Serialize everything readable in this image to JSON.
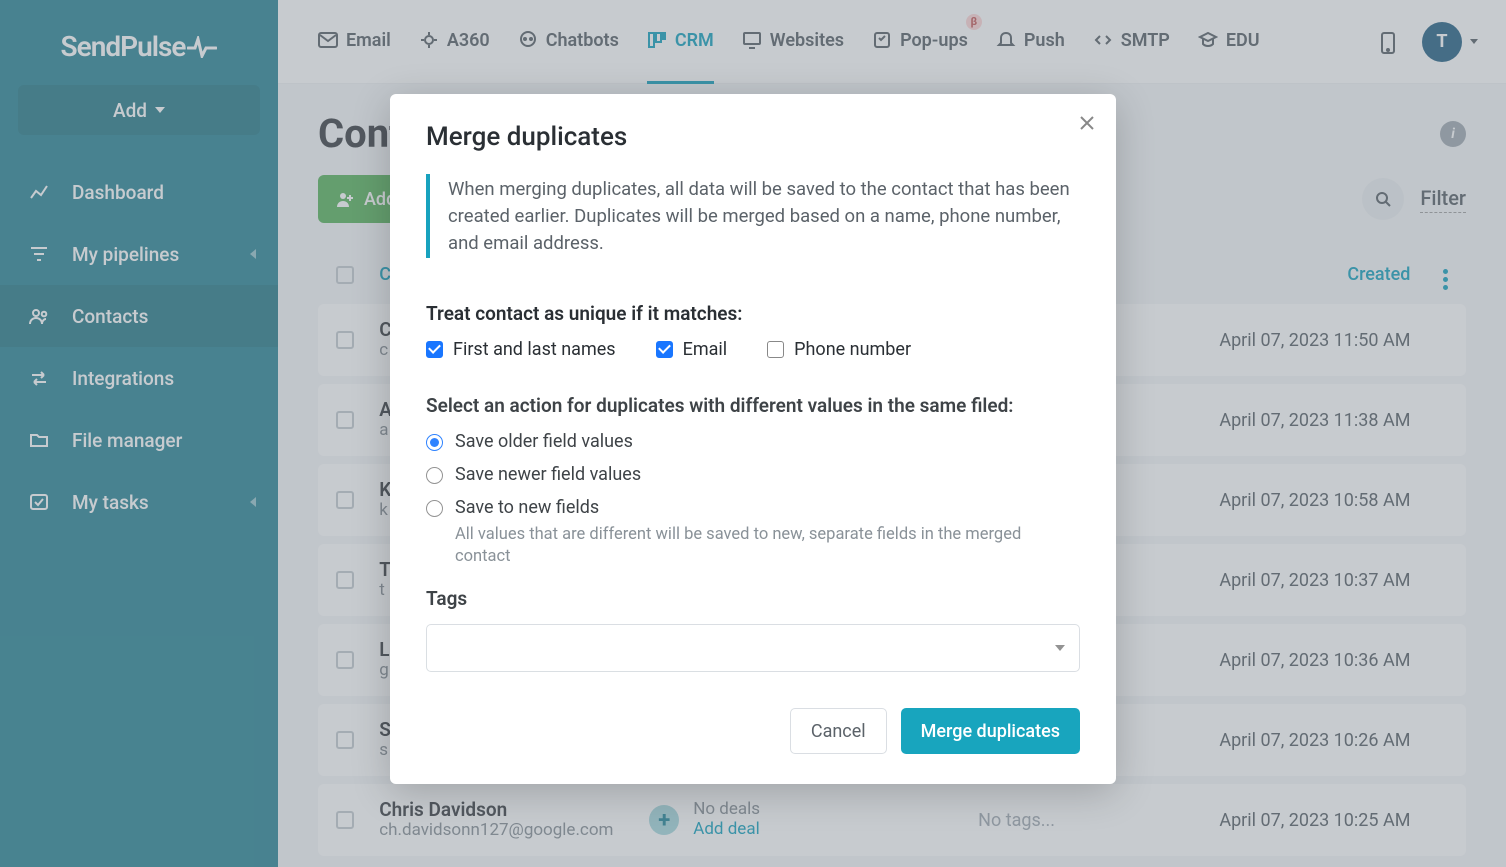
{
  "brand": "SendPulse",
  "sidebar": {
    "add_label": "Add",
    "items": [
      {
        "label": "Dashboard"
      },
      {
        "label": "My pipelines",
        "chevron": true
      },
      {
        "label": "Contacts",
        "active": true
      },
      {
        "label": "Integrations"
      },
      {
        "label": "File manager"
      },
      {
        "label": "My tasks",
        "chevron": true
      }
    ]
  },
  "topnav": [
    {
      "label": "Email"
    },
    {
      "label": "A360"
    },
    {
      "label": "Chatbots"
    },
    {
      "label": "CRM",
      "active": true
    },
    {
      "label": "Websites"
    },
    {
      "label": "Pop-ups",
      "badge": "β"
    },
    {
      "label": "Push"
    },
    {
      "label": "SMTP"
    },
    {
      "label": "EDU"
    }
  ],
  "avatar_initial": "T",
  "page": {
    "title": "Contacts",
    "add_contact": "Add contact",
    "merge_dup_btn": "Merge duplicates",
    "filter": "Filter",
    "columns": {
      "contact": "Contact",
      "created": "Created"
    }
  },
  "contacts": [
    {
      "name": "C",
      "email": "c",
      "created": "April 07, 2023 11:50 AM"
    },
    {
      "name": "A",
      "email": "a",
      "created": "April 07, 2023 11:38 AM"
    },
    {
      "name": "K",
      "email": "k",
      "created": "April 07, 2023 10:58 AM"
    },
    {
      "name": "T",
      "email": "t",
      "created": "April 07, 2023 10:37 AM"
    },
    {
      "name": "L",
      "email": "g",
      "created": "April 07, 2023 10:36 AM"
    },
    {
      "name": "S",
      "email": "s",
      "created": "April 07, 2023 10:26 AM"
    },
    {
      "name": "Chris Davidson",
      "email": "ch.davidsonn127@google.com",
      "created": "April 07, 2023 10:25 AM"
    }
  ],
  "deal": {
    "no_deals": "No deals",
    "add_deal": "Add deal"
  },
  "tags": {
    "empty": "No tags..."
  },
  "modal": {
    "title": "Merge duplicates",
    "info": "When merging duplicates, all data will be saved to the contact that has been created earlier. Duplicates will be merged based on a name, phone number, and email address.",
    "unique_label": "Treat contact as unique if it matches:",
    "unique_opts": {
      "names": "First and last names",
      "email": "Email",
      "phone": "Phone number"
    },
    "action_label": "Select an action for duplicates with different values in the same filed:",
    "action_opts": {
      "older": "Save older field values",
      "newer": "Save newer field values",
      "new_fields": "Save to new fields",
      "new_fields_hint": "All values that are different will be saved to new, separate fields in the merged contact"
    },
    "tags_label": "Tags",
    "cancel": "Cancel",
    "merge": "Merge duplicates"
  }
}
